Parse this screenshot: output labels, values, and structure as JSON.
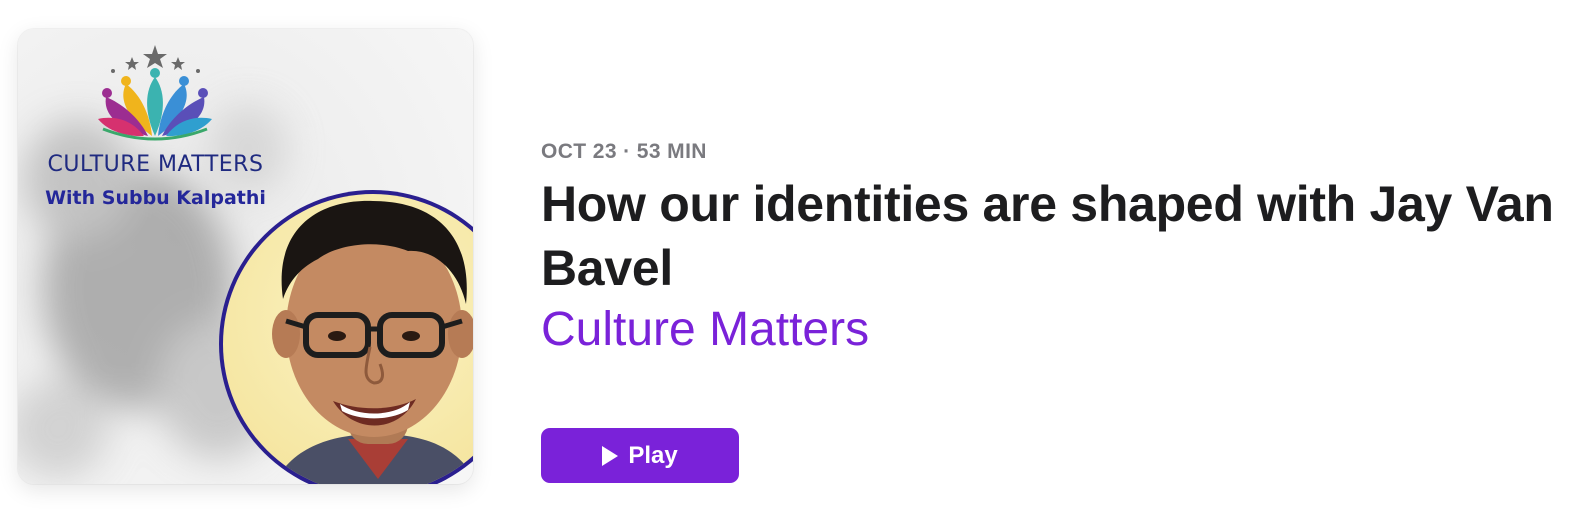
{
  "artwork": {
    "title": "CULTURE MATTERS",
    "subtitle": "With Subbu Kalpathi"
  },
  "episode": {
    "date": "OCT 23",
    "duration": "53 MIN",
    "meta": "OCT 23 · 53 MIN",
    "title": "How our identities are shaped with Jay Van Bavel",
    "show": "Culture Matters"
  },
  "actions": {
    "play_label": "Play",
    "play_icon": "play-triangle-icon"
  },
  "colors": {
    "accent": "#7a22d9",
    "title_text": "#1d1d1f",
    "meta_text": "#7a7a7f",
    "art_navy": "#1f2a80"
  }
}
